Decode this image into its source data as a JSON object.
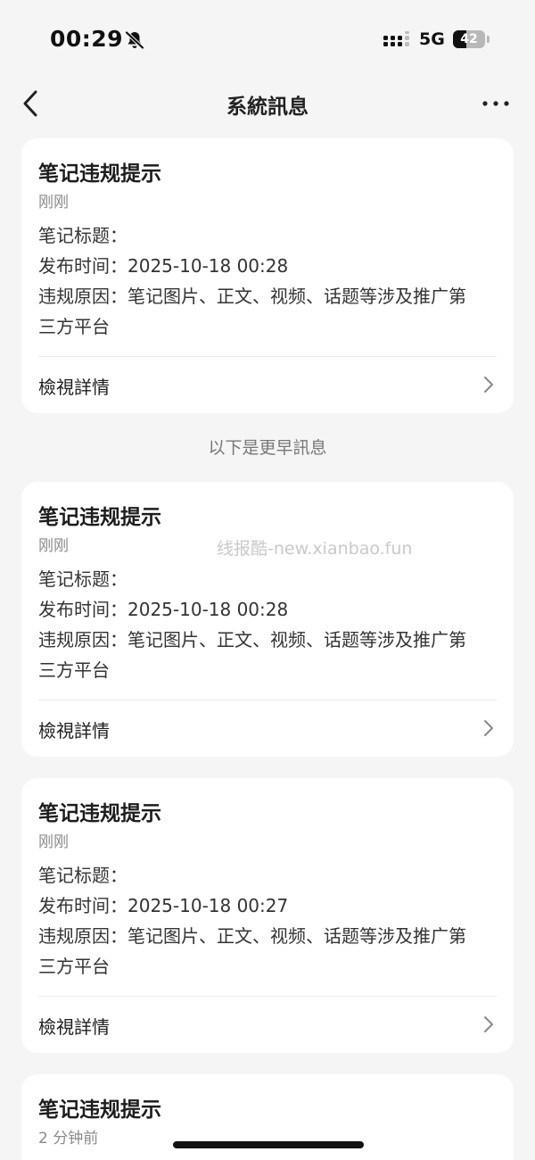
{
  "status_bar": {
    "time": "00:29",
    "network": "5G",
    "battery": "42",
    "battery_level": 0.42,
    "bell_icon": "bell-slash-icon",
    "signal_icon": "signal-icon"
  },
  "nav": {
    "title": "系統訊息",
    "back_icon": "chevron-left-icon",
    "more_icon": "more-icon"
  },
  "section_label": "以下是更早訊息",
  "watermark": "线报酷-new.xianbao.fun",
  "cards": [
    {
      "title": "笔记违规提示",
      "time": "刚刚",
      "lines": [
        "笔记标题：",
        "发布时间：2025-10-18 00:28",
        "违规原因：笔记图片、正文、视频、话题等涉及推广第",
        "三方平台"
      ],
      "action": "檢視詳情"
    },
    {
      "title": "笔记违规提示",
      "time": "刚刚",
      "lines": [
        "笔记标题：",
        "发布时间：2025-10-18 00:28",
        "违规原因：笔记图片、正文、视频、话题等涉及推广第",
        "三方平台"
      ],
      "action": "檢視詳情"
    },
    {
      "title": "笔记违规提示",
      "time": "刚刚",
      "lines": [
        "笔记标题：",
        "发布时间：2025-10-18 00:27",
        "违规原因：笔记图片、正文、视频、话题等涉及推广第",
        "三方平台"
      ],
      "action": "檢視詳情"
    },
    {
      "title": "笔记违规提示",
      "time": "2 分钟前"
    }
  ],
  "colors": {
    "background": "#f5f5f5",
    "card": "#ffffff",
    "text_primary": "#1d1d1d",
    "text_secondary": "#8a8a8a"
  }
}
